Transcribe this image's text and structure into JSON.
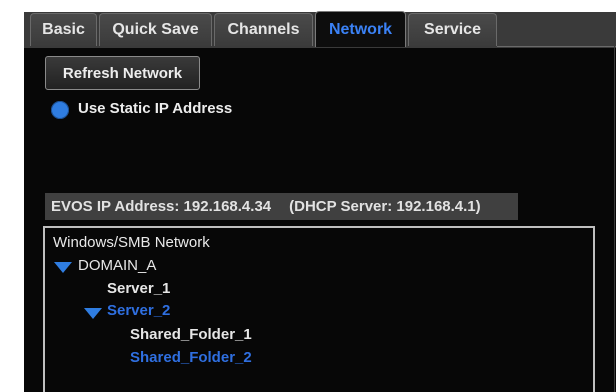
{
  "tabs": [
    {
      "label": "Basic",
      "active": false
    },
    {
      "label": "Quick Save",
      "active": false
    },
    {
      "label": "Channels",
      "active": false
    },
    {
      "label": "Network",
      "active": true
    },
    {
      "label": "Service",
      "active": false
    }
  ],
  "actions": {
    "refresh_label": "Refresh Network"
  },
  "static_ip": {
    "label": "Use Static IP Address",
    "selected": true
  },
  "status": {
    "ip_text": "EVOS IP Address: 192.168.4.34",
    "dhcp_text": "(DHCP Server: 192.168.4.1)"
  },
  "tree": {
    "root": "Windows/SMB Network",
    "domain": "DOMAIN_A",
    "server1": "Server_1",
    "server2": "Server_2",
    "folder1": "Shared_Folder_1",
    "folder2": "Shared_Folder_2"
  },
  "colors": {
    "accent": "#2f7de1",
    "background": "#070707",
    "tab": "#3b3b3b",
    "status_bar": "#404040"
  },
  "icons": {
    "expand": "triangle-down-icon",
    "radio": "radio-selected-icon"
  }
}
